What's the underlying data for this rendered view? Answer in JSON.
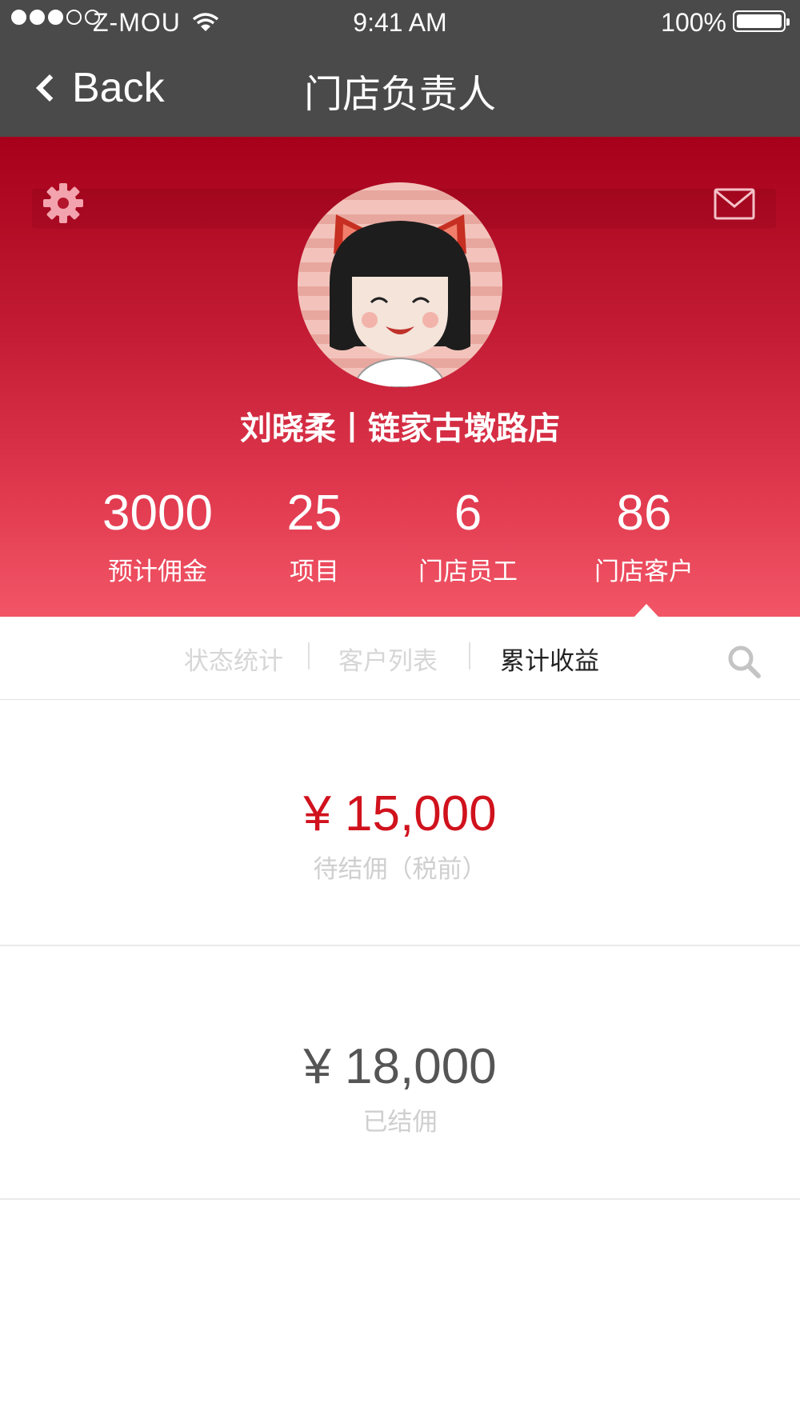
{
  "status_bar": {
    "carrier": "Z-MOU",
    "time": "9:41 AM",
    "battery": "100%"
  },
  "nav": {
    "back_label": "Back",
    "title": "门店负责人"
  },
  "profile": {
    "name_store": "刘晓柔丨链家古墩路店"
  },
  "stats": [
    {
      "value": "3000",
      "label": "预计佣金"
    },
    {
      "value": "25",
      "label": "项目"
    },
    {
      "value": "6",
      "label": "门店员工"
    },
    {
      "value": "86",
      "label": "门店客户"
    }
  ],
  "tabs": [
    {
      "label": "状态统计"
    },
    {
      "label": "客户列表"
    },
    {
      "label": "累计收益"
    }
  ],
  "earnings": [
    {
      "amount": "¥ 15,000",
      "label": "待结佣（税前）"
    },
    {
      "amount": "¥ 18,000",
      "label": "已结佣"
    }
  ],
  "icons": {
    "settings": "gear-icon",
    "mail": "mail-icon",
    "search": "search-icon",
    "back": "chevron-left-icon",
    "wifi": "wifi-icon"
  },
  "colors": {
    "nav_bg": "#4a4a4a",
    "hero_top": "#a7001b",
    "hero_bottom": "#f25667",
    "pending_amount": "#d0121d",
    "settled_amount": "#555555"
  }
}
